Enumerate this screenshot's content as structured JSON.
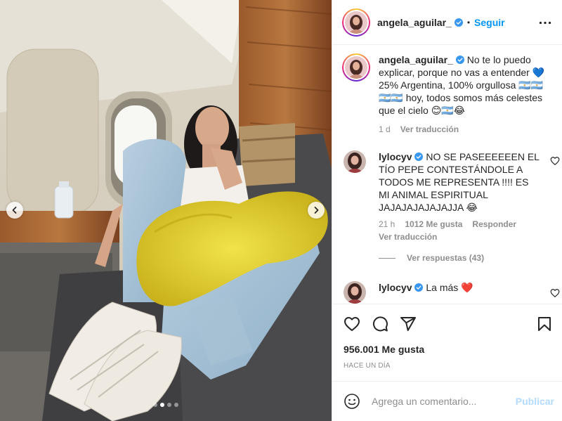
{
  "post": {
    "author": "angela_aguilar_",
    "follow_label": "Seguir",
    "separator": "•",
    "carousel": {
      "slide_count": 4,
      "active_slide": 2
    }
  },
  "caption": {
    "author": "angela_aguilar_",
    "text": "No te lo puedo explicar, porque no vas a entender 💙 25% Argentina, 100% orgullosa 🇦🇷🇦🇷🇦🇷🇦🇷 hoy, todos somos más celestes que el cielo 😊🇦🇷😂",
    "time": "1 d",
    "translate_label": "Ver traducción"
  },
  "comments": [
    {
      "author": "lylocyv",
      "text": "NO SE PASEEEEEEN EL TÍO PEPE CONTESTÁNDOLE A TODOS ME REPRESENTA !!!! ES MI ANIMAL ESPIRITUAL JAJAJAJAJAJAJJA 😂",
      "time": "21 h",
      "likes": "1012 Me gusta",
      "reply_label": "Responder",
      "translate_label": "Ver traducción",
      "replies_label": "Ver respuestas (43)"
    },
    {
      "author": "lylocyv",
      "text": "La más ❤️"
    }
  ],
  "stats": {
    "likes": "956.001 Me gusta",
    "date": "HACE UN DÍA"
  },
  "composer": {
    "placeholder": "Agrega un comentario...",
    "publish_label": "Publicar"
  },
  "colors": {
    "accent": "#0095f6",
    "verified": "#3897f0",
    "muted": "#8e8e8e",
    "text": "#262626",
    "publish_disabled": "#b3dbff",
    "heart": "#ed4956"
  },
  "icons": {
    "nav_prev": "chevron-left-icon",
    "nav_next": "chevron-right-icon",
    "more": "more-horizontal-icon",
    "like": "heart-outline-icon",
    "comment": "comment-bubble-icon",
    "share": "paper-plane-icon",
    "save": "bookmark-icon",
    "emoji": "emoji-smile-icon",
    "verified": "verified-badge-icon"
  }
}
